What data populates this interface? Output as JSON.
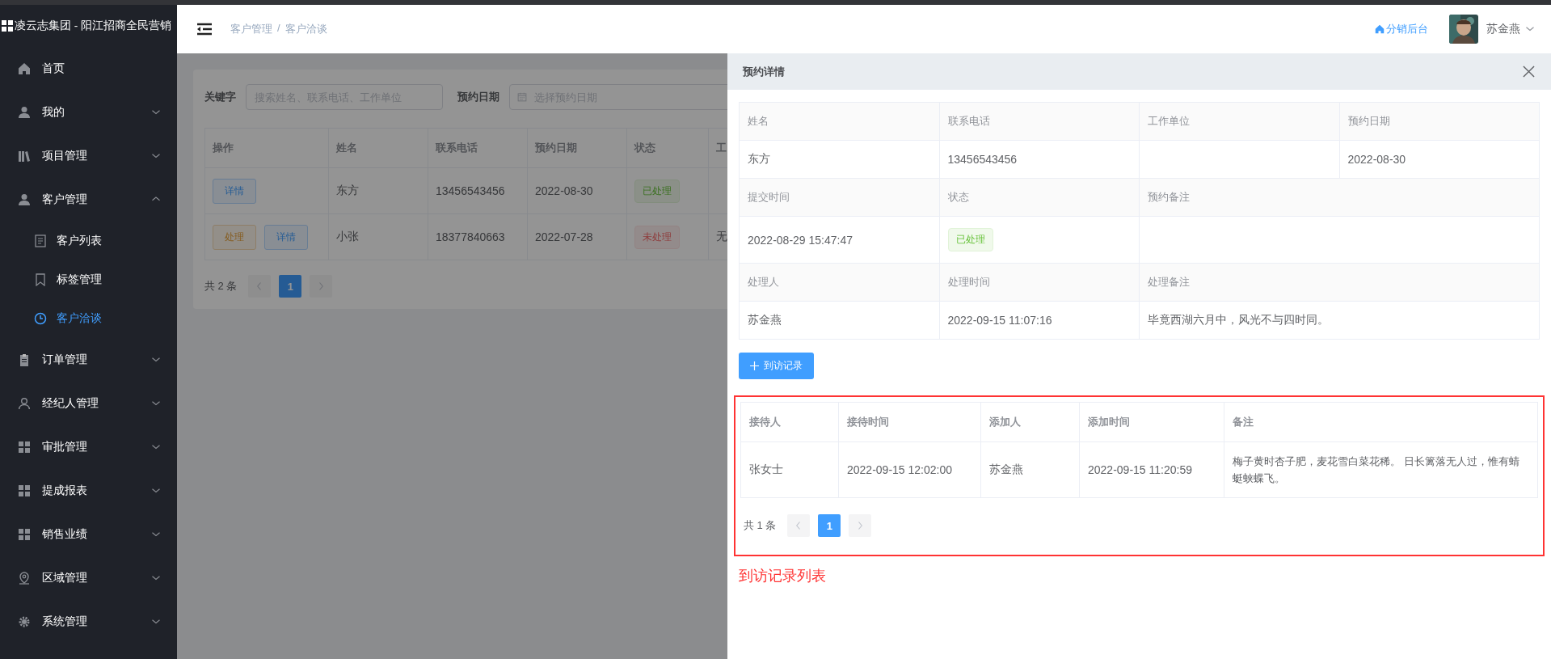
{
  "app": {
    "title": "凌云志集团 - 阳江招商全民营销"
  },
  "sidebar": {
    "items": [
      {
        "label": "首页",
        "kind": "link"
      },
      {
        "label": "我的",
        "kind": "group",
        "expanded": false
      },
      {
        "label": "项目管理",
        "kind": "group",
        "expanded": false
      },
      {
        "label": "客户管理",
        "kind": "group",
        "expanded": true,
        "children": [
          {
            "label": "客户列表",
            "selected": false
          },
          {
            "label": "标签管理",
            "selected": false
          },
          {
            "label": "客户洽谈",
            "selected": true
          }
        ]
      },
      {
        "label": "订单管理",
        "kind": "group",
        "expanded": false
      },
      {
        "label": "经纪人管理",
        "kind": "group",
        "expanded": false
      },
      {
        "label": "审批管理",
        "kind": "group",
        "expanded": false
      },
      {
        "label": "提成报表",
        "kind": "group",
        "expanded": false
      },
      {
        "label": "销售业绩",
        "kind": "group",
        "expanded": false
      },
      {
        "label": "区域管理",
        "kind": "group",
        "expanded": false
      },
      {
        "label": "系统管理",
        "kind": "group",
        "expanded": false
      }
    ]
  },
  "header": {
    "breadcrumb": [
      "客户管理",
      "客户洽谈"
    ],
    "separator": "/",
    "link": "分销后台",
    "user": "苏金燕"
  },
  "filters": [
    {
      "label": "关键字",
      "kind": "text",
      "placeholder": "搜索姓名、联系电话、工作单位"
    },
    {
      "label": "预约日期",
      "kind": "date",
      "placeholder": "选择预约日期"
    }
  ],
  "table": {
    "columns": [
      "操作",
      "姓名",
      "联系电话",
      "预约日期",
      "状态",
      "工"
    ],
    "rows": [
      {
        "cells": [
          {
            "actions": [
              {
                "label": "详情",
                "kind": "primary"
              }
            ]
          },
          "东方",
          "13456543456",
          "2022-08-30",
          {
            "status": {
              "label": "已处理",
              "kind": "success"
            }
          },
          ""
        ]
      },
      {
        "cells": [
          {
            "actions": [
              {
                "label": "处理",
                "kind": "warning"
              },
              {
                "label": "详情",
                "kind": "primary"
              }
            ]
          },
          "小张",
          "18377840663",
          "2022-07-28",
          {
            "status": {
              "label": "未处理",
              "kind": "danger"
            }
          },
          "无"
        ]
      }
    ]
  },
  "pagination": {
    "total": "共 2 条",
    "pages": [
      {
        "label": "1",
        "selected": true
      }
    ]
  },
  "drawer": {
    "title": "预约详情",
    "details": [
      [
        {
          "label": "姓名",
          "value": "东方"
        },
        {
          "label": "联系电话",
          "value": "13456543456"
        },
        {
          "label": "工作单位"
        },
        {
          "label": "预约日期",
          "value": "2022-08-30"
        }
      ],
      [
        {
          "label": "提交时间",
          "value": "2022-08-29 15:47:47"
        },
        {
          "label": "状态",
          "tag": {
            "label": "已处理",
            "kind": "success"
          }
        },
        {
          "label": "预约备注"
        }
      ],
      [
        {
          "label": "处理人",
          "value": "苏金燕"
        },
        {
          "label": "处理时间",
          "value": "2022-09-15 11:07:16"
        },
        {
          "label": "处理备注",
          "value": "毕竟西湖六月中，风光不与四时同。"
        }
      ]
    ],
    "add_button": "到访记录",
    "visits": {
      "columns": [
        "接待人",
        "接待时间",
        "添加人",
        "添加时间",
        "备注"
      ],
      "rows": [
        [
          "张女士",
          "2022-09-15 12:02:00",
          "苏金燕",
          "2022-09-15 11:20:59",
          "梅子黄时杏子肥，麦花雪白菜花稀。 日长篱落无人过，惟有蜻蜓蛱蝶飞。"
        ]
      ],
      "pagination": {
        "total": "共 1 条",
        "pages": [
          {
            "label": "1",
            "selected": true
          }
        ]
      }
    },
    "annotation": "到访记录列表"
  }
}
